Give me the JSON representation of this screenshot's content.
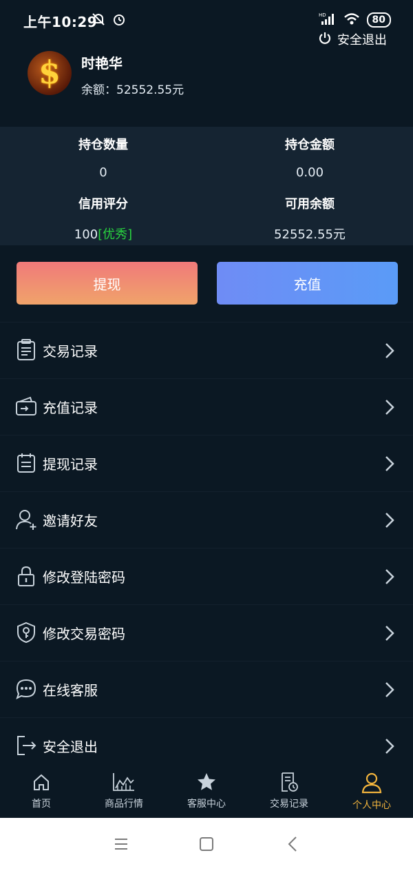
{
  "status_bar": {
    "time": "上午10:29",
    "battery": "80",
    "network": "HD"
  },
  "header": {
    "logout_label": "安全退出",
    "user_name": "时艳华",
    "balance_label": "余额：",
    "balance_value": "52552.55元"
  },
  "stats": {
    "position_count_label": "持仓数量",
    "position_count_value": "0",
    "position_amount_label": "持仓金额",
    "position_amount_value": "0.00",
    "credit_label": "信用评分",
    "credit_value": "100",
    "credit_tag": "[优秀]",
    "available_label": "可用余额",
    "available_value": "52552.55元"
  },
  "actions": {
    "withdraw": "提现",
    "recharge": "充值"
  },
  "menu": [
    {
      "label": "交易记录",
      "icon": "clipboard-icon"
    },
    {
      "label": "充值记录",
      "icon": "wallet-icon"
    },
    {
      "label": "提现记录",
      "icon": "calendar-icon"
    },
    {
      "label": "邀请好友",
      "icon": "add-user-icon"
    },
    {
      "label": "修改登陆密码",
      "icon": "lock-icon"
    },
    {
      "label": "修改交易密码",
      "icon": "shield-key-icon"
    },
    {
      "label": "在线客服",
      "icon": "chat-icon"
    },
    {
      "label": "安全退出",
      "icon": "exit-icon"
    }
  ],
  "tabs": [
    {
      "label": "首页",
      "icon": "home-icon"
    },
    {
      "label": "商品行情",
      "icon": "chart-icon"
    },
    {
      "label": "客服中心",
      "icon": "star-icon"
    },
    {
      "label": "交易记录",
      "icon": "record-icon"
    },
    {
      "label": "个人中心",
      "icon": "person-icon",
      "active": true
    }
  ],
  "colors": {
    "background": "#0b1823",
    "panel": "#152432",
    "accent_active": "#f2b43d",
    "credit_green": "#29d33f"
  }
}
